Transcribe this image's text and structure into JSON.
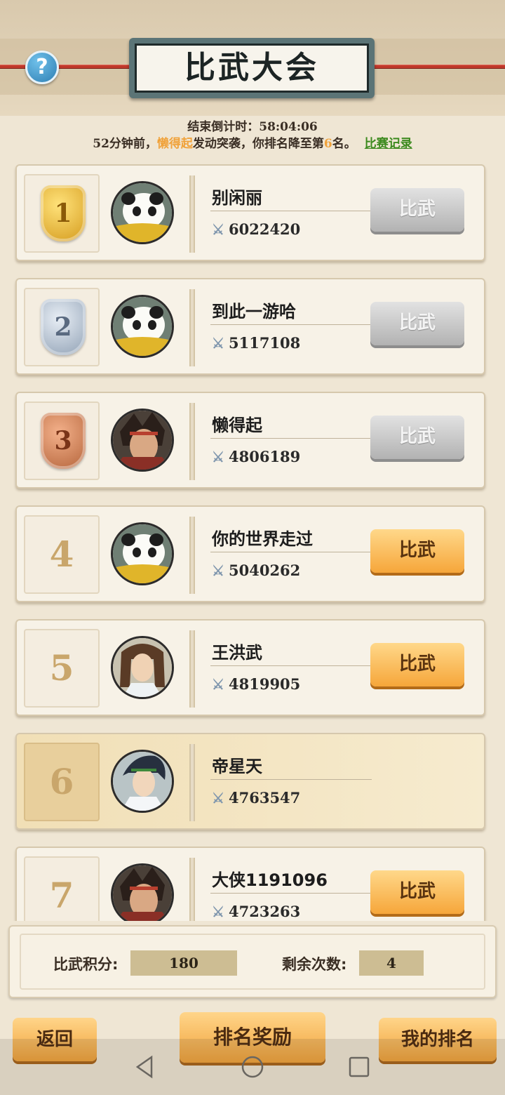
{
  "header": {
    "title": "比武大会",
    "help_icon": "question-icon",
    "countdown": "结束倒计时：58:04:06",
    "news": {
      "prefix": "52分钟前，",
      "attacker": "懒得起",
      "middle": "发动突袭，你排名降至第",
      "rank": "6",
      "suffix": "名。",
      "record_link": "比赛记录"
    }
  },
  "leaderboard": [
    {
      "rank": "1",
      "medal": "gold",
      "avatar": "panda-avatar",
      "name": "别闲丽",
      "power": "6022420",
      "button": "比武",
      "button_state": "disabled"
    },
    {
      "rank": "2",
      "medal": "silver",
      "avatar": "panda-avatar",
      "name": "到此一游哈",
      "power": "5117108",
      "button": "比武",
      "button_state": "disabled"
    },
    {
      "rank": "3",
      "medal": "bronze",
      "avatar": "warrior-avatar",
      "name": "懒得起",
      "power": "4806189",
      "button": "比武",
      "button_state": "disabled"
    },
    {
      "rank": "4",
      "medal": "",
      "avatar": "panda-avatar",
      "name": "你的世界走过",
      "power": "5040262",
      "button": "比武",
      "button_state": "active"
    },
    {
      "rank": "5",
      "medal": "",
      "avatar": "swordsman-avatar",
      "name": "王洪武",
      "power": "4819905",
      "button": "比武",
      "button_state": "active"
    },
    {
      "rank": "6",
      "medal": "",
      "avatar": "hero-avatar",
      "name": "帝星天",
      "power": "4763547",
      "button": "",
      "button_state": "self"
    },
    {
      "rank": "7",
      "medal": "",
      "avatar": "warrior-avatar",
      "name": "大侠1191096",
      "power": "4723263",
      "button": "比武",
      "button_state": "active"
    }
  ],
  "stats": {
    "points_label": "比武积分:",
    "points_value": "180",
    "remaining_label": "剩余次数:",
    "remaining_value": "4"
  },
  "bottom_buttons": {
    "back": "返回",
    "rewards": "排名奖励",
    "my_rank": "我的排名"
  },
  "colors": {
    "accent_orange": "#f0a23a",
    "record_green": "#3c8a1e",
    "disabled_gray": "#b2b2b2"
  }
}
